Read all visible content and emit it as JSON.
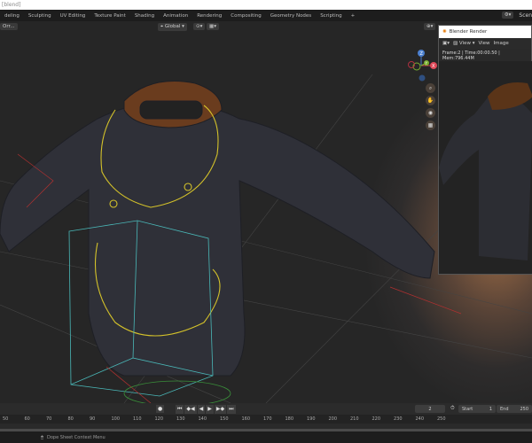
{
  "window": {
    "title": "[blend]"
  },
  "workspace_tabs": [
    "deling",
    "Sculpting",
    "UV Editing",
    "Texture Paint",
    "Shading",
    "Animation",
    "Rendering",
    "Compositing",
    "Geometry Nodes",
    "Scripting",
    "+"
  ],
  "scene_label": "Scen",
  "viewport_header": {
    "mode": "Orr...",
    "orientation": "Global"
  },
  "gizmo": {
    "x": "X",
    "y": "Y",
    "z": "Z"
  },
  "render_window": {
    "title": "Blender Render",
    "view_dropdown": "View",
    "menu": [
      "View",
      "Image"
    ],
    "info": "Frame:2 | Time:00:00.50 | Mem:796.44M"
  },
  "timeline": {
    "current_frame": "2",
    "start_label": "Start",
    "start": "1",
    "end_label": "End",
    "end": "250",
    "ticks": [
      "50",
      "60",
      "70",
      "80",
      "90",
      "100",
      "110",
      "120",
      "130",
      "140",
      "150",
      "160",
      "170",
      "180",
      "190",
      "200",
      "210",
      "220",
      "230",
      "240",
      "250"
    ]
  },
  "status_bar": {
    "text": "Dope Sheet Context Menu"
  },
  "colors": {
    "accent": "#e87d0d",
    "background": "#1d1d1d"
  }
}
